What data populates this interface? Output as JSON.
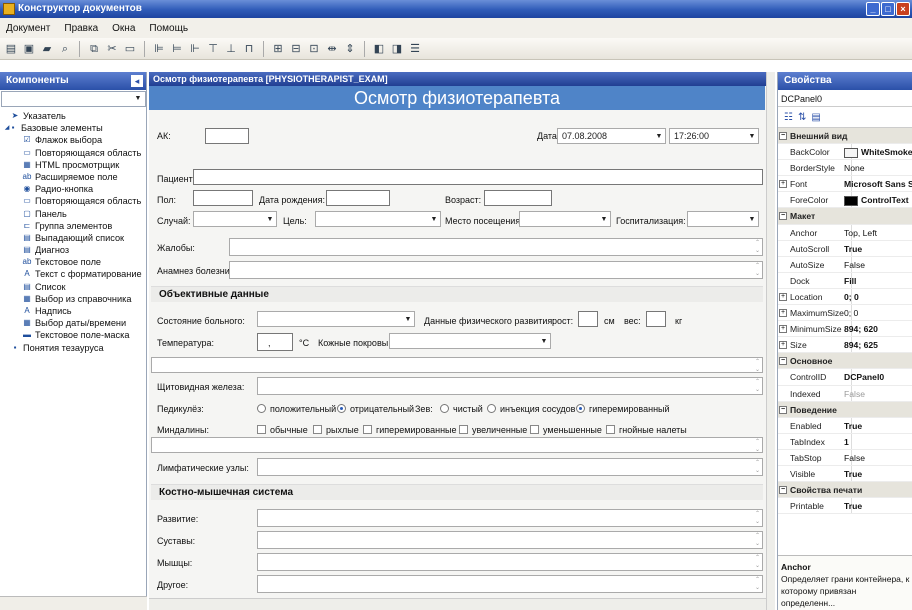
{
  "window": {
    "title": "Конструктор документов"
  },
  "menu": [
    "Документ",
    "Правка",
    "Окна",
    "Помощь"
  ],
  "left_panel": {
    "title": "Компоненты",
    "tree": [
      {
        "label": "Указатель",
        "icon": "pointer-icon",
        "indent": 1
      },
      {
        "label": "Базовые элементы",
        "icon": "folder-icon",
        "indent": 0
      },
      {
        "label": "Флажок выбора",
        "icon": "checkbox-icon",
        "indent": 2
      },
      {
        "label": "Повторяющаяся область",
        "icon": "repeat-area-icon",
        "indent": 2
      },
      {
        "label": "HTML просмотрщик",
        "icon": "html-viewer-icon",
        "indent": 2
      },
      {
        "label": "Расширяемое поле",
        "icon": "textfield-icon",
        "indent": 2
      },
      {
        "label": "Радио-кнопка",
        "icon": "radio-icon",
        "indent": 2
      },
      {
        "label": "Повторяющаяся область",
        "icon": "repeat-area-icon",
        "indent": 2
      },
      {
        "label": "Панель",
        "icon": "panel-icon",
        "indent": 2
      },
      {
        "label": "Группа элементов",
        "icon": "group-icon",
        "indent": 2
      },
      {
        "label": "Выпадающий список",
        "icon": "dropdown-icon",
        "indent": 2
      },
      {
        "label": "Диагноз",
        "icon": "diagnosis-icon",
        "indent": 2
      },
      {
        "label": "Текстовое поле",
        "icon": "textfield-icon",
        "indent": 2
      },
      {
        "label": "Текст с форматирование",
        "icon": "richtext-icon",
        "indent": 2
      },
      {
        "label": "Список",
        "icon": "list-icon",
        "indent": 2
      },
      {
        "label": "Выбор из справочника",
        "icon": "lookup-icon",
        "indent": 2
      },
      {
        "label": "Надпись",
        "icon": "label-icon",
        "indent": 2
      },
      {
        "label": "Выбор даты/времени",
        "icon": "datetime-icon",
        "indent": 2
      },
      {
        "label": "Текстовое поле-маска",
        "icon": "masked-field-icon",
        "indent": 2
      },
      {
        "label": "Понятия тезауруса",
        "icon": "thesaurus-icon",
        "indent": 1
      }
    ]
  },
  "doc": {
    "header": "Осмотр физиотерапевта [PHYSIOTHERAPIST_EXAM]",
    "title": "Осмотр физиотерапевта",
    "ak_label": "АК:",
    "date_label": "Дата:",
    "date_value": "07.08.2008",
    "time_value": "17:26:00",
    "patient_label": "Пациент:",
    "sex_label": "Пол:",
    "birth_label": "Дата рождения:",
    "age_label": "Возраст:",
    "case_label": "Случай:",
    "goal_label": "Цель:",
    "visit_label": "Место посещения:",
    "hosp_label": "Госпитализация:",
    "complaints_label": "Жалобы:",
    "anamnesis_label": "Анамнез болезни:",
    "objective_section": "Объективные данные",
    "state_label": "Состояние больного:",
    "phys_label": "Данные физического развития:",
    "height_label": "рост:",
    "height_unit": "см",
    "weight_label": "вес:",
    "weight_unit": "кг",
    "temp_label": "Температура:",
    "temp_value": ",",
    "temp_unit": "°C",
    "skin_label": "Кожные покровы:",
    "thyroid_label": "Щитовидная железа:",
    "lice_label": "Педикулёз:",
    "lice_options": [
      {
        "label": "положительный",
        "on": false
      },
      {
        "label": "отрицательный",
        "on": true
      }
    ],
    "throat_label": "Зев:",
    "throat_options": [
      {
        "label": "чистый",
        "on": false
      },
      {
        "label": "инъекция сосудов",
        "on": false
      },
      {
        "label": "гиперемированный",
        "on": true
      }
    ],
    "tonsils_label": "Миндалины:",
    "tonsil_options": [
      "обычные",
      "рыхлые",
      "гиперемированные",
      "увеличенные",
      "уменьшенные",
      "гнойные налеты"
    ],
    "lymph_label": "Лимфатические узлы:",
    "musculo_section": "Костно-мышечная система",
    "dev_label": "Развитие:",
    "joints_label": "Суставы:",
    "muscles_label": "Мышцы:",
    "other_label": "Другое:"
  },
  "properties": {
    "title": "Свойства",
    "object": "DCPanel0",
    "rows": [
      {
        "type": "cat",
        "name": "Внешний вид"
      },
      {
        "name": "BackColor",
        "value": "WhiteSmoke",
        "swatch": "#f5f5f5",
        "bold": true
      },
      {
        "name": "BorderStyle",
        "value": "None"
      },
      {
        "name": "Font",
        "value": "Microsoft Sans Se",
        "bold": true,
        "expand": true
      },
      {
        "name": "ForeColor",
        "value": "ControlText",
        "swatch": "#000000",
        "bold": true
      },
      {
        "type": "cat",
        "name": "Макет"
      },
      {
        "name": "Anchor",
        "value": "Top, Left"
      },
      {
        "name": "AutoScroll",
        "value": "True",
        "bold": true
      },
      {
        "name": "AutoSize",
        "value": "False"
      },
      {
        "name": "Dock",
        "value": "Fill",
        "bold": true
      },
      {
        "name": "Location",
        "value": "0; 0",
        "bold": true,
        "expand": true
      },
      {
        "name": "MaximumSize",
        "value": "0; 0",
        "expand": true
      },
      {
        "name": "MinimumSize",
        "value": "894; 620",
        "bold": true,
        "expand": true
      },
      {
        "name": "Size",
        "value": "894; 625",
        "bold": true,
        "expand": true
      },
      {
        "type": "cat",
        "name": "Основное"
      },
      {
        "name": "ControlID",
        "value": "DCPanel0",
        "bold": true
      },
      {
        "name": "Indexed",
        "value": "False",
        "grey": true
      },
      {
        "type": "cat",
        "name": "Поведение"
      },
      {
        "name": "Enabled",
        "value": "True",
        "bold": true
      },
      {
        "name": "TabIndex",
        "value": "1",
        "bold": true
      },
      {
        "name": "TabStop",
        "value": "False"
      },
      {
        "name": "Visible",
        "value": "True",
        "bold": true
      },
      {
        "type": "cat",
        "name": "Свойства печати"
      },
      {
        "name": "Printable",
        "value": "True",
        "bold": true
      }
    ],
    "desc_title": "Anchor",
    "desc_text": "Определяет грани контейнера, к которому привязан определенн..."
  }
}
